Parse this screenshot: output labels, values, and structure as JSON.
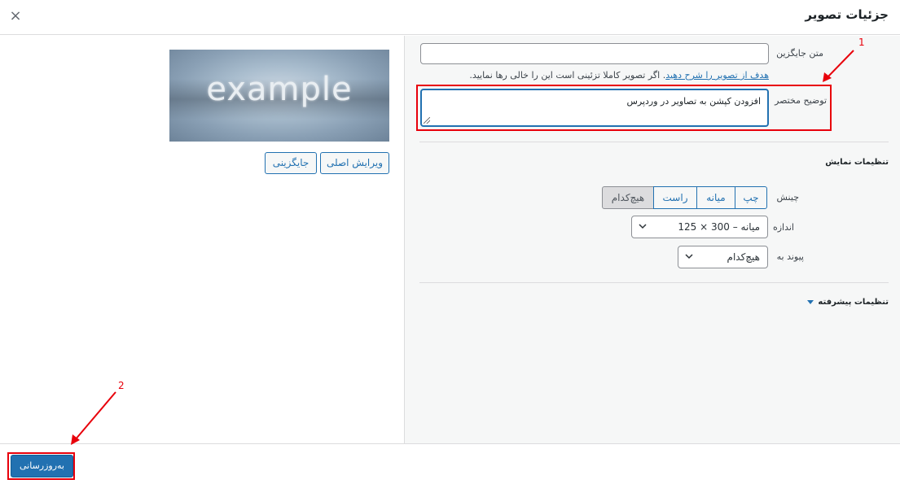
{
  "modal": {
    "title": "جزئیات تصویر",
    "close_icon": "×"
  },
  "preview": {
    "image_text": "example",
    "edit_original_label": "ویرایش اصلی",
    "replace_label": "جایگزینی"
  },
  "fields": {
    "alt_text_label": "متن جایگزین",
    "alt_text_value": "",
    "help_link_text": "هدف از تصویر را شرح دهید",
    "help_rest_text": ". اگر تصویر کاملا تزئینی است این را خالی رها نمایید.",
    "caption_label": "توضیح مختصر",
    "caption_value": "افزودن کپشن به تصاویر در وردپرس"
  },
  "display_settings": {
    "title": "تنظیمات نمایش",
    "align_label": "چینش",
    "align_options": [
      "هیچ‌کدام",
      "راست",
      "میانه",
      "چپ"
    ],
    "align_selected": "هیچ‌کدام",
    "size_label": "اندازه",
    "size_value": "میانه – 300 × 125",
    "link_label": "پیوند به",
    "link_value": "هیچ‌کدام"
  },
  "advanced": {
    "label": "تنظیمات پیشرفته"
  },
  "footer": {
    "update_label": "به‌روزرسانی"
  },
  "annotations": {
    "label_1": "1",
    "label_2": "2",
    "highlight_color": "#e8000b"
  },
  "colors": {
    "accent": "#2271b1",
    "panel_bg": "#f6f7f7"
  }
}
